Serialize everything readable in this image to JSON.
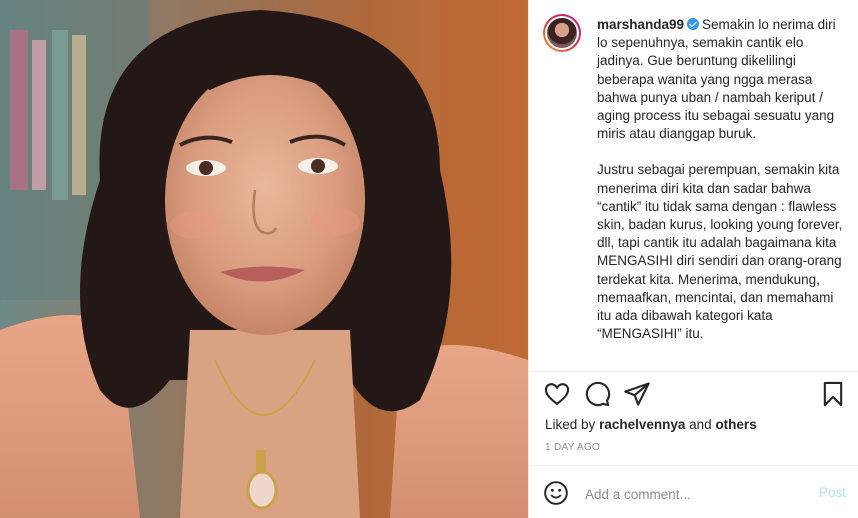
{
  "post": {
    "photo_icon": "selfie-photo",
    "username": "marshanda99",
    "verified_icon": "verified-badge-icon",
    "caption_p1": "Semakin lo nerima diri lo sepenuhnya, semakin cantik elo jadinya. Gue beruntung dikelilingi beberapa wanita yang ngga merasa bahwa punya uban / nambah keriput / aging process itu sebagai sesuatu yang miris atau dianggap buruk.",
    "caption_p2": "Justru sebagai perempuan, semakin kita menerima diri kita dan sadar bahwa “cantik” itu tidak sama dengan : flawless skin, badan kurus, looking young forever, dll, tapi cantik itu adalah bagaimana kita MENGASIHI diri sendiri dan orang-orang terdekat kita. Menerima, mendukung, memaafkan, mencintai, dan memahami itu ada dibawah kategori kata “MENGASIHI” itu."
  },
  "actions": {
    "icons": [
      "heart-icon",
      "comment-icon",
      "share-icon",
      "bookmark-icon"
    ]
  },
  "likes": {
    "prefix": "Liked by",
    "user": "rachelvennya",
    "joiner": "and",
    "others": "others"
  },
  "timestamp": "1 DAY AGO",
  "comment": {
    "placeholder": "Add a comment...",
    "post_label": "Post"
  },
  "colors": {
    "accent_disabled": "#b2dffc",
    "verified": "#3897f0",
    "secondary_text": "#8e8e8e"
  }
}
